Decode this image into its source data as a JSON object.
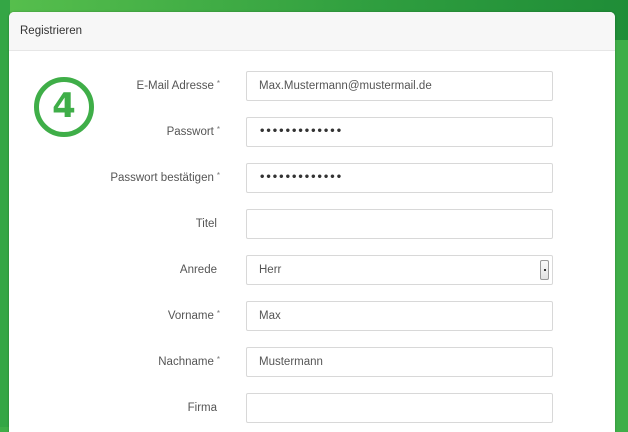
{
  "panel": {
    "title": "Registrieren"
  },
  "step": {
    "number": "4"
  },
  "form": {
    "fields": [
      {
        "label": "E-Mail Adresse",
        "required": "*",
        "value": "Max.Mustermann@mustermail.de"
      },
      {
        "label": "Passwort",
        "required": "*",
        "value": "•••••••••••••"
      },
      {
        "label": "Passwort bestätigen",
        "required": "*",
        "value": "•••••••••••••"
      },
      {
        "label": "Titel",
        "required": "",
        "value": ""
      },
      {
        "label": "Anrede",
        "required": "",
        "value": "Herr"
      },
      {
        "label": "Vorname",
        "required": "*",
        "value": "Max"
      },
      {
        "label": "Nachname",
        "required": "*",
        "value": "Mustermann"
      },
      {
        "label": "Firma",
        "required": "",
        "value": ""
      }
    ]
  },
  "colors": {
    "accent": "#3fae48"
  }
}
